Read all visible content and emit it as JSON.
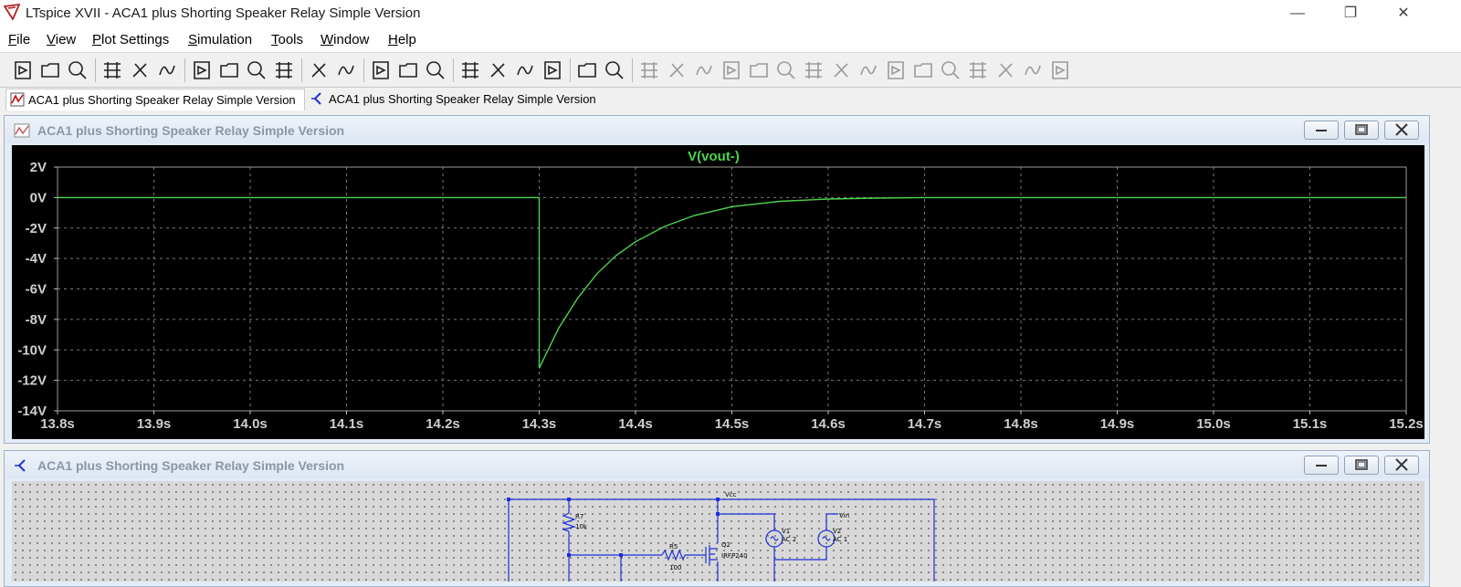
{
  "window": {
    "title": "LTspice XVII - ACA1 plus Shorting Speaker Relay Simple Version",
    "controls": [
      "—",
      "❐",
      "✕"
    ]
  },
  "menu": [
    {
      "u": "F",
      "rest": "ile"
    },
    {
      "u": "V",
      "rest": "iew"
    },
    {
      "u": "P",
      "rest": "lot Settings"
    },
    {
      "u": "S",
      "rest": "imulation"
    },
    {
      "u": "T",
      "rest": "ools"
    },
    {
      "u": "W",
      "rest": "indow"
    },
    {
      "u": "H",
      "rest": "elp"
    }
  ],
  "toolbar": {
    "icons": [
      "run-icon",
      "open-icon",
      "save-icon",
      "control-panel-icon",
      "halt-icon",
      "pan-icon",
      "zoom-area-icon",
      "zoom-in-icon",
      "zoom-out-icon",
      "zoom-fit-icon",
      "autorange-icon",
      "grid-icon",
      "tile-horizontal-icon",
      "cascade-icon",
      "tile-vertical-icon",
      "cut-icon",
      "copy-icon",
      "paste-icon",
      "find-icon",
      "print-icon",
      "print-setup-icon",
      "draw-wire-icon",
      "ground-icon",
      "label-icon",
      "resistor-icon",
      "capacitor-icon",
      "inductor-icon",
      "diode-icon",
      "component-icon",
      "move-icon",
      "drag-icon",
      "undo-icon",
      "redo-icon",
      "rotate-icon",
      "mirror-icon",
      "text-icon",
      "spice-directive-icon"
    ]
  },
  "tabs": [
    {
      "label": "ACA1 plus Shorting Speaker Relay Simple Version",
      "kind": "plot",
      "active": true
    },
    {
      "label": "ACA1 plus Shorting Speaker Relay Simple Version",
      "kind": "schematic",
      "active": false
    }
  ],
  "plot_window": {
    "title": "ACA1 plus Shorting Speaker Relay Simple Version"
  },
  "schematic_window": {
    "title": "ACA1 plus Shorting Speaker Relay Simple Version",
    "labels": {
      "vcc": "Vcc",
      "r7": "R7",
      "r7_val": "10k",
      "r5": "R5",
      "r5_val": "100",
      "q2": "Q2",
      "q2_val": "IRFP240",
      "v1": "V1",
      "v1_val": "AC 2",
      "v2": "V2",
      "v2_val": "AC 1",
      "vin": "Vin"
    }
  },
  "colors": {
    "trace": "#4cd44c",
    "grid": "#7a7a7a",
    "axis_text": "#cfcfcf",
    "wire": "#1f2fd6"
  },
  "chart_data": {
    "type": "line",
    "title": "V(vout-)",
    "xlabel": "",
    "ylabel": "",
    "xlim": [
      13.8,
      15.2
    ],
    "ylim": [
      -14,
      2
    ],
    "x_ticks": [
      "13.8s",
      "13.9s",
      "14.0s",
      "14.1s",
      "14.2s",
      "14.3s",
      "14.4s",
      "14.5s",
      "14.6s",
      "14.7s",
      "14.8s",
      "14.9s",
      "15.0s",
      "15.1s",
      "15.2s"
    ],
    "y_ticks": [
      "2V",
      "0V",
      "-2V",
      "-4V",
      "-6V",
      "-8V",
      "-10V",
      "-12V",
      "-14V"
    ],
    "series": [
      {
        "name": "V(vout-)",
        "x": [
          13.8,
          14.3,
          14.3,
          14.32,
          14.34,
          14.36,
          14.38,
          14.4,
          14.43,
          14.46,
          14.5,
          14.55,
          14.6,
          14.65,
          14.7,
          15.2
        ],
        "y": [
          0,
          0,
          -11.2,
          -8.6,
          -6.6,
          -5.0,
          -3.8,
          -2.9,
          -1.9,
          -1.2,
          -0.6,
          -0.25,
          -0.1,
          -0.04,
          0,
          0
        ]
      }
    ]
  }
}
